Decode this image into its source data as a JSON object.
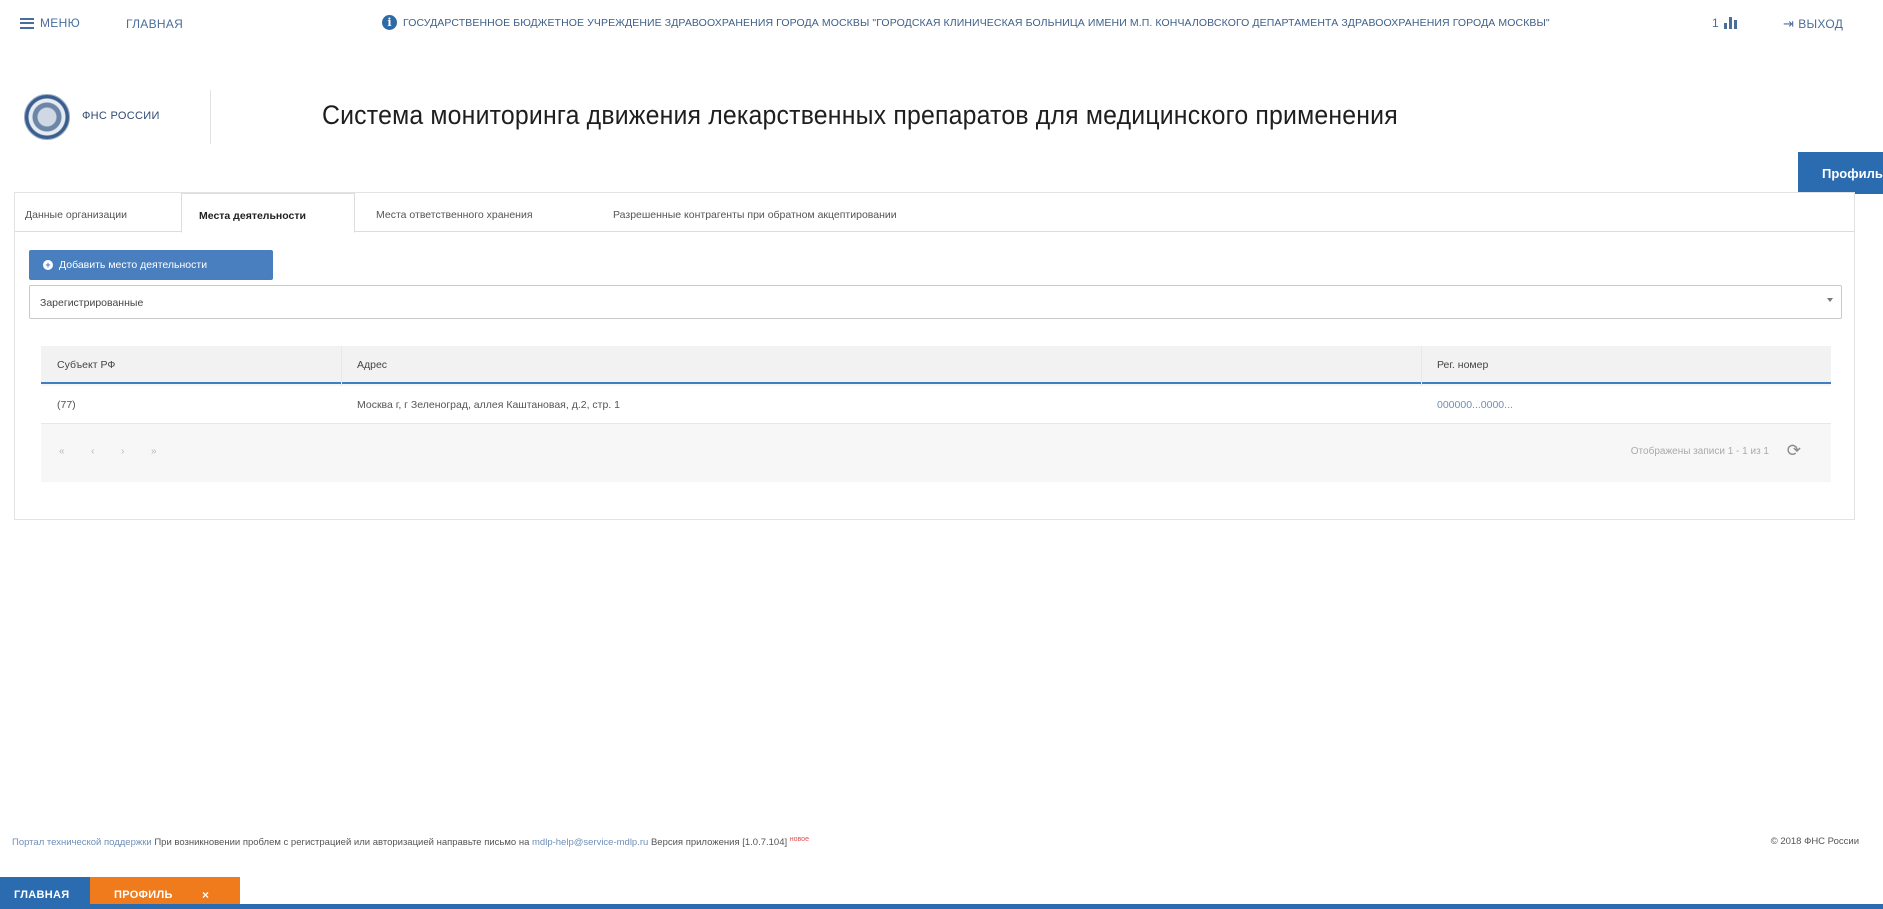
{
  "topbar": {
    "menu_label": "МЕНЮ",
    "home_label": "ГЛАВНАЯ",
    "org_name": "ГОСУДАРСТВЕННОЕ БЮДЖЕТНОЕ УЧРЕЖДЕНИЕ ЗДРАВООХРАНЕНИЯ ГОРОДА МОСКВЫ \"ГОРОДСКАЯ КЛИНИЧЕСКАЯ БОЛЬНИЦА ИМЕНИ М.П. КОНЧАЛОВСКОГО ДЕПАРТАМЕНТА ЗДРАВООХРАНЕНИЯ ГОРОДА МОСКВЫ\"",
    "chart_label": "1",
    "logout_label": "ВЫХОД"
  },
  "header": {
    "logo_text": "ФНС РОССИИ",
    "app_title": "Система мониторинга движения лекарственных препаратов для медицинского применения",
    "profile_tab": "Профиль"
  },
  "tabs": [
    {
      "label": "Данные организации"
    },
    {
      "label": "Места деятельности"
    },
    {
      "label": "Места ответственного хранения"
    },
    {
      "label": "Разрешенные контрагенты при обратном акцептировании"
    }
  ],
  "actions": {
    "add_place_label": "Добавить место деятельности"
  },
  "filter": {
    "selected": "Зарегистрированные"
  },
  "grid": {
    "columns": [
      "Субъект РФ",
      "Адрес",
      "Рег. номер"
    ],
    "rows": [
      {
        "region": "(77)",
        "address": "Москва г, г Зеленоград, аллея Каштановая, д.2, стр. 1",
        "reg_number": "000000...0000..."
      }
    ],
    "pager": {
      "first": "«",
      "prev": "‹",
      "next": "›",
      "last": "»",
      "info": "Отображены записи 1 - 1 из 1"
    }
  },
  "footer": {
    "support_link": "Портал технической поддержки",
    "text": "При возникновении проблем с регистрацией или авторизацией направьте письмо на",
    "email": "mdlp-help@service-mdlp.ru",
    "version": "Версия приложения [1.0.7.104]",
    "new_badge": "новое",
    "copyright": "© 2018 ФНС России"
  },
  "bottom_tabs": {
    "home": "ГЛАВНАЯ",
    "profile": "ПРОФИЛЬ",
    "close": "×"
  },
  "colors": {
    "accent": "#2b6cb0",
    "button": "#4a7fbf",
    "active_bottom_tab": "#f07b1d"
  }
}
